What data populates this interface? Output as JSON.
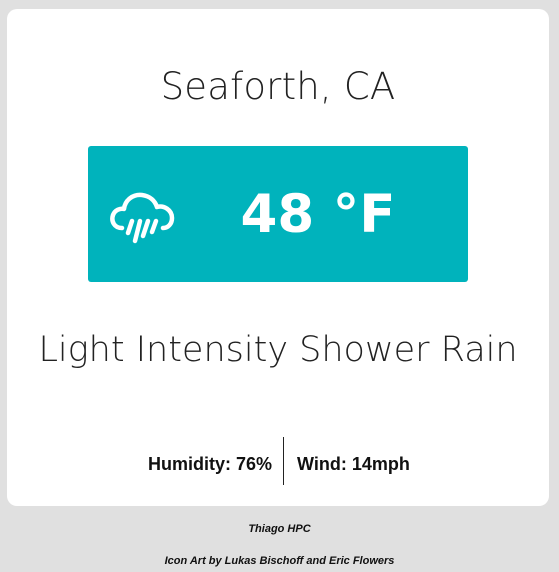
{
  "location": {
    "city": "Seaforth, CA"
  },
  "current": {
    "temperature": "48 °F",
    "condition": "Light Intensity Shower Rain",
    "icon": "rain-cloud-icon"
  },
  "stats": {
    "humidity": "Humidity: 76%",
    "wind": "Wind: 14mph"
  },
  "footer": {
    "author": "Thiago HPC",
    "credit": "Icon Art by Lukas Bischoff and Eric Flowers"
  },
  "colors": {
    "accent": "#00b3bc",
    "background": "#e0e0e0",
    "card": "#ffffff"
  }
}
